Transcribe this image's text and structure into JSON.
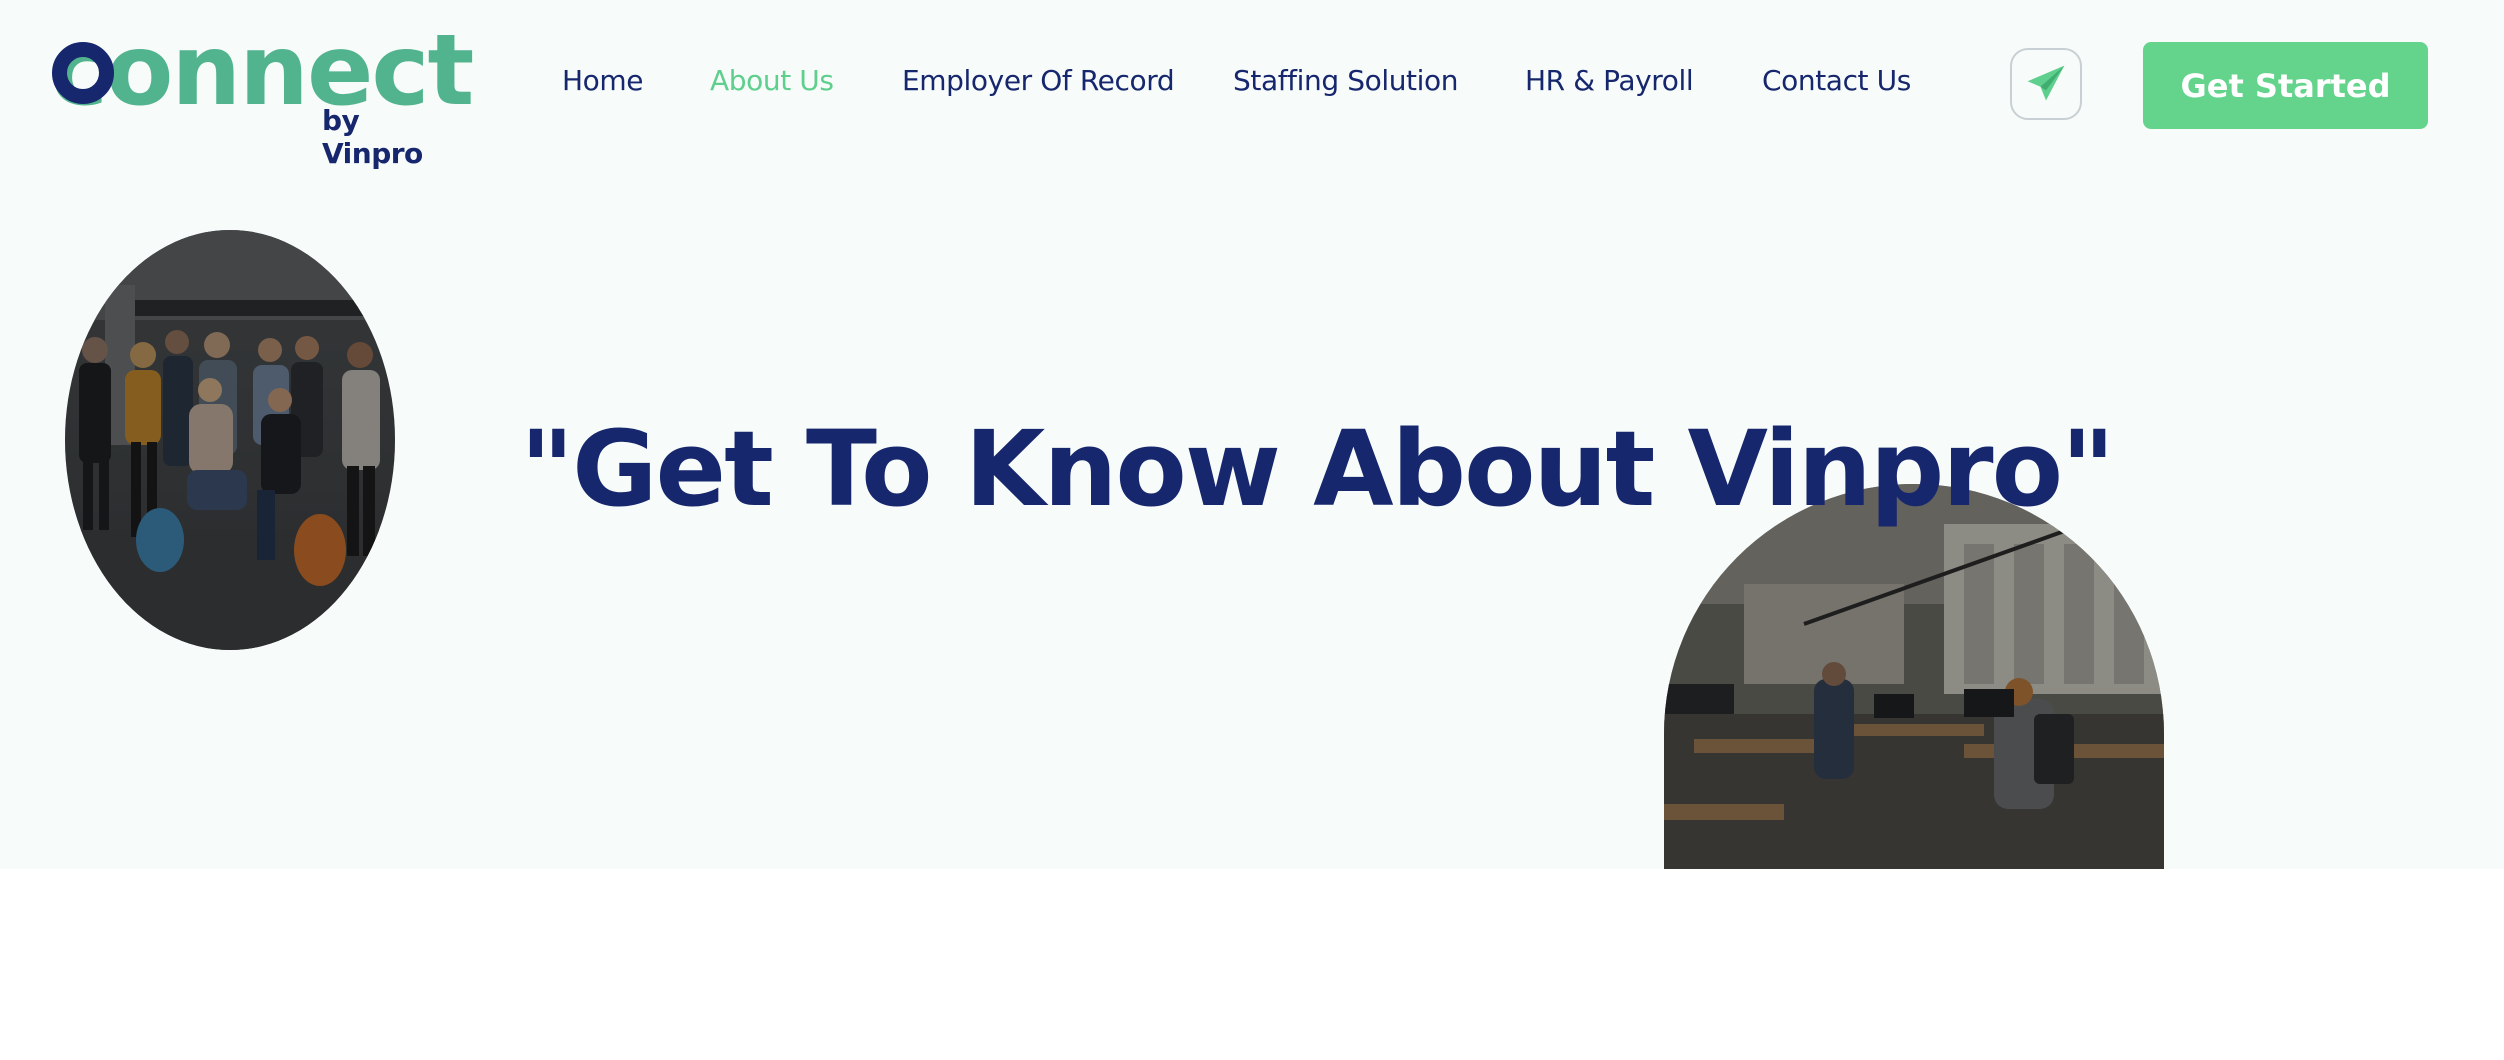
{
  "logo": {
    "wordmark": "connect",
    "sub": "by Vinpro"
  },
  "nav": {
    "items": [
      {
        "label": "Home",
        "active": false
      },
      {
        "label": "About Us",
        "active": true
      },
      {
        "label": "Employer Of Record",
        "active": false
      },
      {
        "label": "Staffing Solution",
        "active": false
      },
      {
        "label": "HR & Payroll",
        "active": false
      },
      {
        "label": "Contact Us",
        "active": false
      }
    ]
  },
  "header": {
    "telegram_icon": "paper-plane-icon",
    "cta_label": "Get Started"
  },
  "hero": {
    "title": "\"Get To Know About Vinpro\""
  },
  "colors": {
    "brand_navy": "#17276d",
    "brand_green": "#52b48e",
    "accent_green": "#64d48d",
    "hero_background": "#f7fbfa"
  }
}
